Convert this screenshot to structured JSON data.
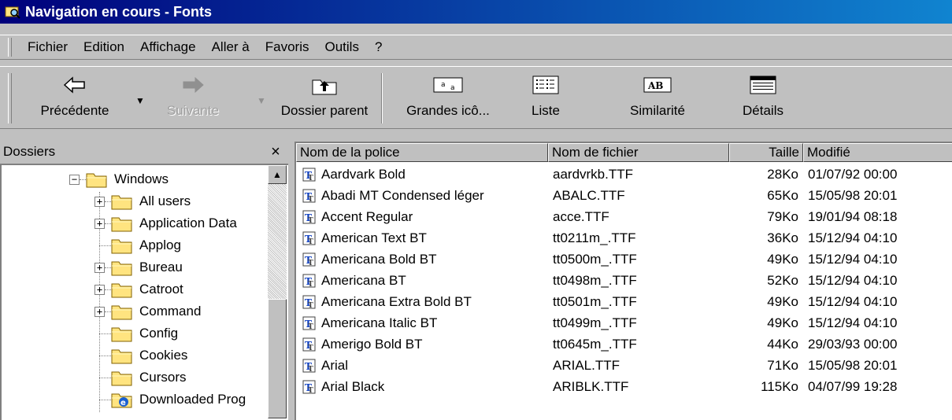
{
  "window": {
    "title": "Navigation en cours - Fonts"
  },
  "menu": [
    "Fichier",
    "Edition",
    "Affichage",
    "Aller à",
    "Favoris",
    "Outils",
    "?"
  ],
  "toolbar": {
    "back": "Précédente",
    "forward": "Suivante",
    "parent": "Dossier parent",
    "large_icons": "Grandes icô...",
    "list": "Liste",
    "similarity": "Similarité",
    "details": "Détails"
  },
  "folders_panel": {
    "title": "Dossiers",
    "close": "×",
    "items": [
      {
        "label": "Windows",
        "expander": "−"
      },
      {
        "label": "All users",
        "expander": "+"
      },
      {
        "label": "Application Data",
        "expander": "+"
      },
      {
        "label": "Applog",
        "expander": ""
      },
      {
        "label": "Bureau",
        "expander": "+"
      },
      {
        "label": "Catroot",
        "expander": "+"
      },
      {
        "label": "Command",
        "expander": "+"
      },
      {
        "label": "Config",
        "expander": ""
      },
      {
        "label": "Cookies",
        "expander": ""
      },
      {
        "label": "Cursors",
        "expander": ""
      },
      {
        "label": "Downloaded Prog",
        "expander": ""
      }
    ]
  },
  "font_list": {
    "columns": [
      "Nom de la police",
      "Nom de fichier",
      "Taille",
      "Modifié"
    ],
    "rows": [
      [
        "Aardvark Bold",
        "aardvrkb.TTF",
        "28Ko",
        "01/07/92 00:00"
      ],
      [
        "Abadi MT Condensed léger",
        "ABALC.TTF",
        "65Ko",
        "15/05/98 20:01"
      ],
      [
        "Accent Regular",
        "acce.TTF",
        "79Ko",
        "19/01/94 08:18"
      ],
      [
        "American Text BT",
        "tt0211m_.TTF",
        "36Ko",
        "15/12/94 04:10"
      ],
      [
        "Americana Bold BT",
        "tt0500m_.TTF",
        "49Ko",
        "15/12/94 04:10"
      ],
      [
        "Americana BT",
        "tt0498m_.TTF",
        "52Ko",
        "15/12/94 04:10"
      ],
      [
        "Americana Extra Bold BT",
        "tt0501m_.TTF",
        "49Ko",
        "15/12/94 04:10"
      ],
      [
        "Americana Italic BT",
        "tt0499m_.TTF",
        "49Ko",
        "15/12/94 04:10"
      ],
      [
        "Amerigo Bold BT",
        "tt0645m_.TTF",
        "44Ko",
        "29/03/93 00:00"
      ],
      [
        "Arial",
        "ARIAL.TTF",
        "71Ko",
        "15/05/98 20:01"
      ],
      [
        "Arial Black",
        "ARIBLK.TTF",
        "115Ko",
        "04/07/99 19:28"
      ]
    ]
  },
  "colors": {
    "titlebar_start": "#00007b",
    "titlebar_end": "#1084d0",
    "folder": "#ffe480"
  }
}
